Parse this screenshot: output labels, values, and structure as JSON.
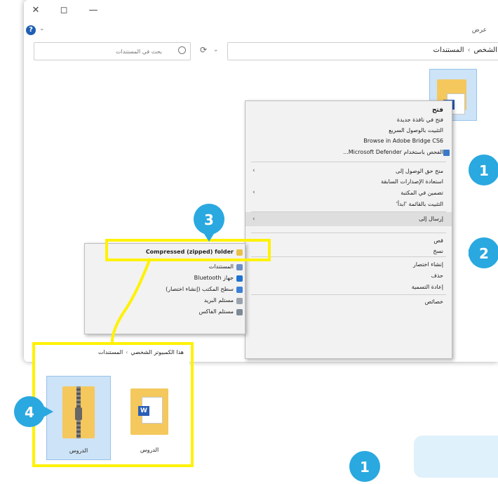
{
  "titlebar": {
    "close": "✕",
    "maximize": "◻",
    "minimize": "—"
  },
  "toolbar": {
    "view_label": "عرض"
  },
  "search": {
    "placeholder": "بحث في المستندات"
  },
  "address": {
    "path": [
      "المستندات",
      "الشخص"
    ]
  },
  "context_menu": {
    "items": [
      {
        "label": "فتح",
        "bold": true
      },
      {
        "label": "فتح في نافذة جديدة"
      },
      {
        "label": "التثبيت بالوصول السريع"
      },
      {
        "label": "Browse in Adobe Bridge CS6"
      },
      {
        "label": "الفحص باستخدام Microsoft Defender...",
        "icon": "shield"
      },
      {
        "label": "منح حق الوصول إلى",
        "submenu": true
      },
      {
        "label": "استعادة الإصدارات السابقة"
      },
      {
        "label": "تضمين في المكتبة",
        "submenu": true
      },
      {
        "label": "التثبيت بالقائمة 'ابدأ'"
      },
      {
        "label": "إرسال إلى",
        "submenu": true,
        "highlight": true
      },
      {
        "label": "قص"
      },
      {
        "label": "نسخ"
      },
      {
        "label": "إنشاء اختصار"
      },
      {
        "label": "حذف"
      },
      {
        "label": "إعادة التسمية"
      },
      {
        "label": "خصائص"
      }
    ]
  },
  "send_to_menu": {
    "items": [
      {
        "label": "Compressed (zipped) folder",
        "highlight": true
      },
      {
        "label": "المستندات"
      },
      {
        "label": "جهاز Bluetooth"
      },
      {
        "label": "سطح المكتب (إنشاء اختصار)"
      },
      {
        "label": "مستلم البريد"
      },
      {
        "label": "مستلم الفاكس"
      }
    ]
  },
  "zip_window": {
    "path": [
      "هذا الكمبيوتر الشخصي",
      "المستندات"
    ],
    "items": [
      {
        "label": "الدروس",
        "type": "zip"
      },
      {
        "label": "الدروس",
        "type": "folder"
      }
    ]
  },
  "markers": [
    "1",
    "2",
    "3",
    "4",
    "1"
  ],
  "colors": {
    "highlight": "#fff200",
    "marker": "#2aa8e0",
    "accent": "#1e5fb4"
  }
}
